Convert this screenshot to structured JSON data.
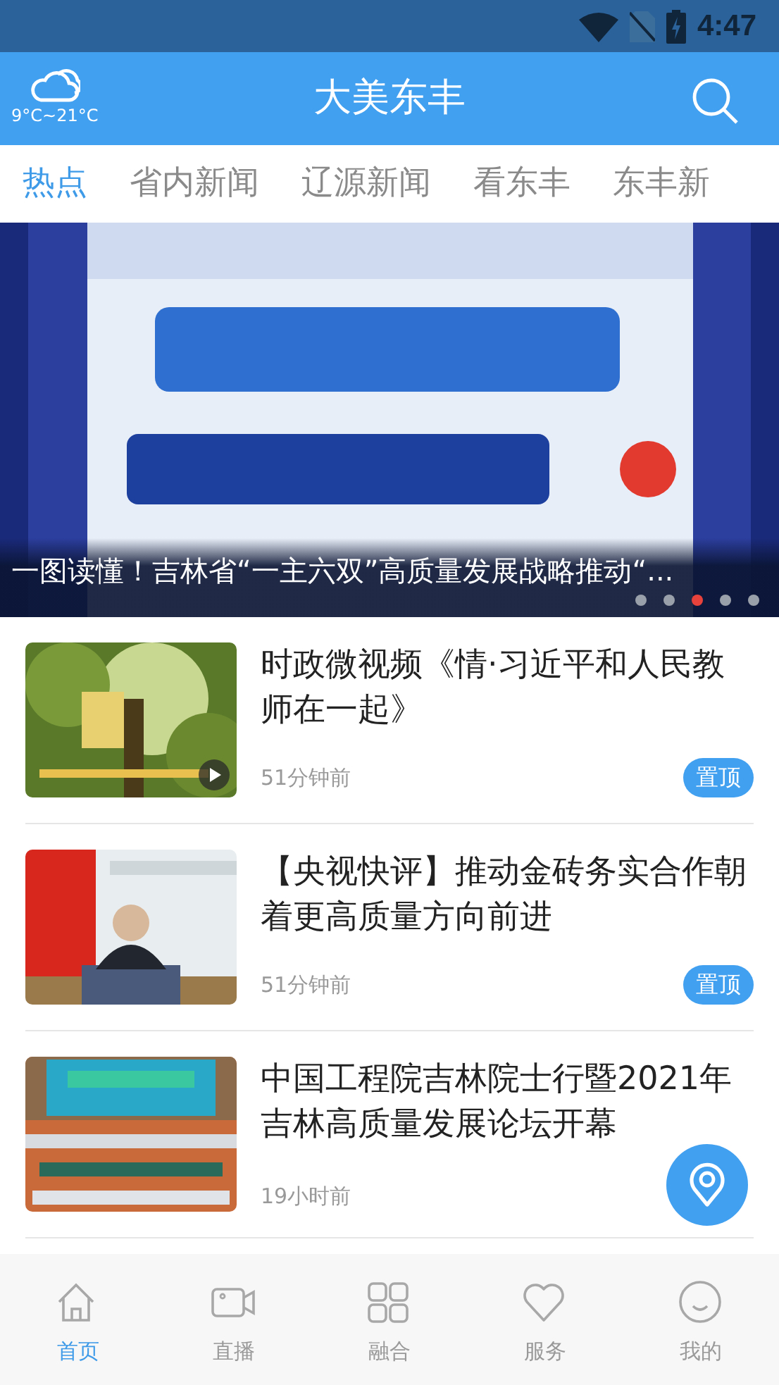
{
  "status_bar": {
    "time": "4:47"
  },
  "header": {
    "weather": "9°C~21°C",
    "title": "大美东丰"
  },
  "tabs": [
    {
      "label": "热点",
      "selected": true
    },
    {
      "label": "省内新闻",
      "selected": false
    },
    {
      "label": "辽源新闻",
      "selected": false
    },
    {
      "label": "看东丰",
      "selected": false
    },
    {
      "label": "东丰新",
      "selected": false
    }
  ],
  "banner": {
    "kind": "picture",
    "caption": "一图读懂！吉林省“一主六双”高质量发展战略推动“...",
    "dots": [
      {
        "selected": false
      },
      {
        "selected": false
      },
      {
        "selected": true
      },
      {
        "selected": false
      },
      {
        "selected": false
      }
    ]
  },
  "news": [
    {
      "video": true,
      "title": "时政微视频《情·习近平和人民教师在一起》",
      "time": "51分钟前",
      "pinned": true,
      "badge": "置顶"
    },
    {
      "video": false,
      "title": "【央视快评】推动金砖务实合作朝着更高质量方向前进",
      "time": "51分钟前",
      "pinned": true,
      "badge": "置顶"
    },
    {
      "video": false,
      "title": "中国工程院吉林院士行暨2021年吉林高质量发展论坛开幕",
      "time": "19小时前",
      "pinned": false
    }
  ],
  "bottom_nav": [
    {
      "label": "首页",
      "selected": true
    },
    {
      "label": "直播",
      "selected": false
    },
    {
      "label": "融合",
      "selected": false
    },
    {
      "label": "服务",
      "selected": false
    },
    {
      "label": "我的",
      "selected": false
    }
  ]
}
